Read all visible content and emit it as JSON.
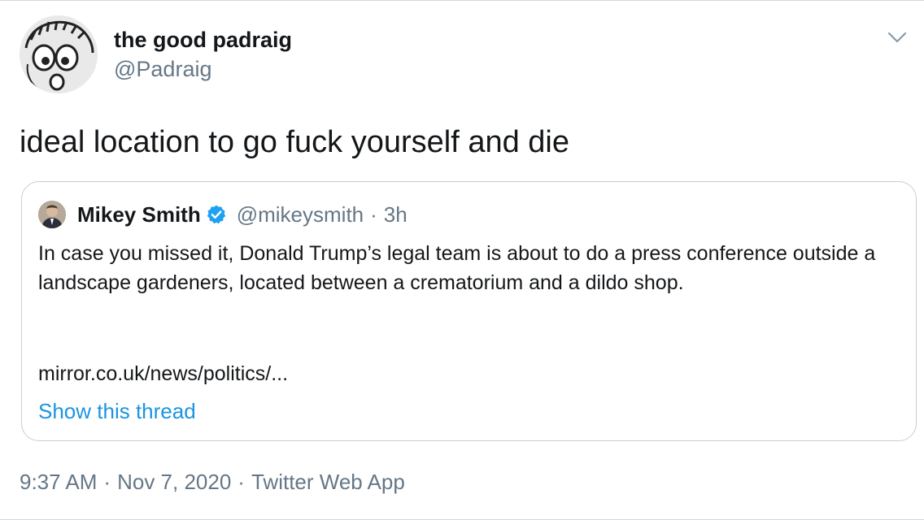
{
  "tweet": {
    "author": {
      "display_name": "the good padraig",
      "handle": "@Padraig",
      "avatar_icon": "hand-drawn-face-avatar"
    },
    "menu_icon": "chevron-down-icon",
    "text": "ideal location to go fuck yourself and die",
    "quoted_tweet": {
      "author": {
        "display_name": "Mikey Smith",
        "handle": "@mikeysmith",
        "verified": true,
        "avatar_icon": "user-photo-avatar"
      },
      "separator": "·",
      "time_ago": "3h",
      "text": "In case you missed it, Donald Trump’s legal team is about to do a press conference outside a landscape gardeners, located between a crematorium and a dildo shop.",
      "link": "mirror.co.uk/news/politics/...",
      "show_thread_label": "Show this thread"
    },
    "timestamp_time": "9:37 AM",
    "timestamp_sep": "·",
    "timestamp_date": "Nov 7, 2020",
    "source_sep": "·",
    "source": "Twitter Web App"
  },
  "colors": {
    "text_primary": "#14171a",
    "text_secondary": "#657786",
    "link_blue": "#1b95e0",
    "verified_blue": "#1da1f2",
    "border": "#c4cfd6"
  }
}
